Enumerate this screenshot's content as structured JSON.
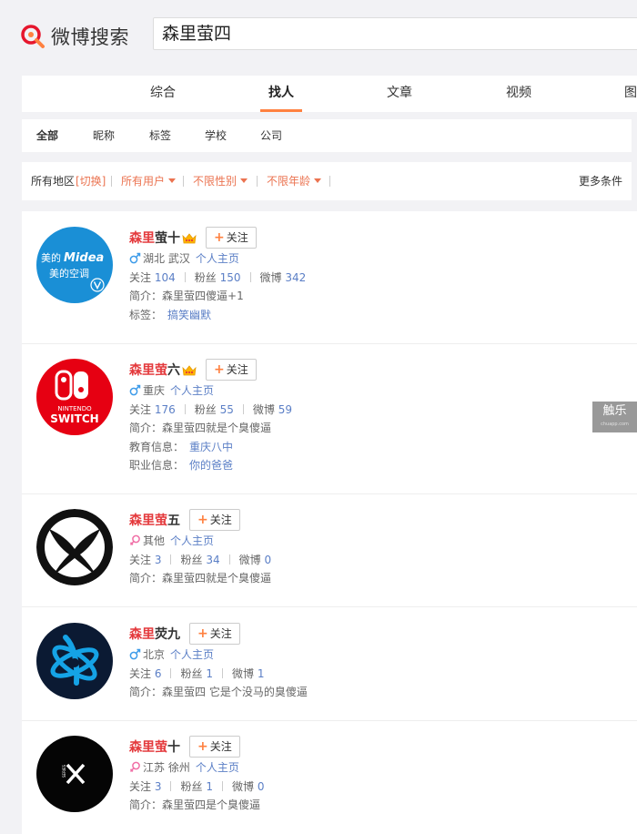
{
  "header": {
    "logo_text": "微博搜索",
    "search_value": "森里萤四"
  },
  "nav": {
    "tabs": [
      "综合",
      "找人",
      "文章",
      "视频",
      "图"
    ],
    "active": 1
  },
  "sub_nav": {
    "tabs": [
      "全部",
      "昵称",
      "标签",
      "学校",
      "公司"
    ],
    "active": 0
  },
  "filters": {
    "region_label": "所有地区",
    "switch_label": "[切换]",
    "users": "所有用户",
    "gender": "不限性别",
    "age": "不限年龄",
    "more": "更多条件"
  },
  "labels": {
    "follow": "关注",
    "home": "个人主页",
    "following": "关注",
    "fans": "粉丝",
    "weibo": "微博",
    "bio": "简介：",
    "tags": "标签：",
    "edu": "教育信息：",
    "job": "职业信息："
  },
  "users": [
    {
      "name_hl": "森里",
      "name_rest": "萤十",
      "crown": true,
      "gender": "male",
      "location": "湖北 武汉",
      "following": "104",
      "fans": "150",
      "weibo": "342",
      "bio": "森里萤四傻逼+1",
      "tags": "搞笑幽默",
      "avatar_brand": "Midea",
      "avatar_text": "美的空调"
    },
    {
      "name_hl": "森里萤",
      "name_rest": "六",
      "crown": true,
      "gender": "male",
      "location": "重庆",
      "following": "176",
      "fans": "55",
      "weibo": "59",
      "bio": "森里萤四就是个臭傻逼",
      "edu": "重庆八中",
      "job": "你的爸爸",
      "avatar_line1": "NINTENDO",
      "avatar_line2": "SWITCH"
    },
    {
      "name_hl": "森里萤",
      "name_rest": "五",
      "crown": false,
      "gender": "female",
      "location": "其他",
      "following": "3",
      "fans": "34",
      "weibo": "0",
      "bio": "森里萤四就是个臭傻逼"
    },
    {
      "name_hl": "森里",
      "name_rest": "荧九",
      "crown": false,
      "gender": "male",
      "location": "北京",
      "following": "6",
      "fans": "1",
      "weibo": "1",
      "bio": "森里萤四 它是个没马的臭傻逼"
    },
    {
      "name_hl": "森里萤",
      "name_rest": "十",
      "crown": false,
      "gender": "female",
      "location": "江苏 徐州",
      "following": "3",
      "fans": "1",
      "weibo": "0",
      "bio": "森里萤四是个臭傻逼",
      "avatar_small": "SERIES"
    }
  ],
  "watermark": {
    "main": "触乐",
    "sub": "chuapp.com"
  },
  "colors": {
    "accent": "#ff8140",
    "highlight": "#e4393c",
    "link": "#5b7fc6"
  }
}
